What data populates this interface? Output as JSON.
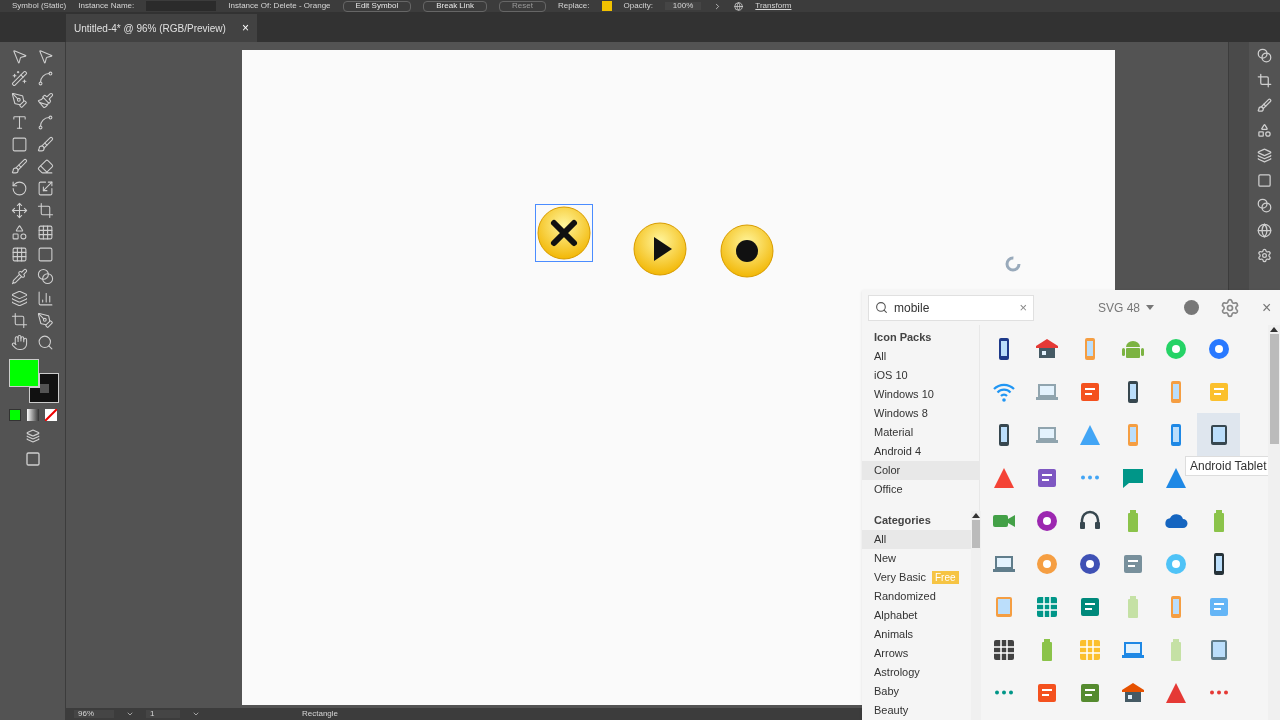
{
  "control_bar": {
    "object_type": "Symbol (Static)",
    "instance_name_label": "Instance Name:",
    "instance_of": "Instance Of: Delete - Orange",
    "buttons": [
      {
        "label": "Edit Symbol",
        "disabled": false
      },
      {
        "label": "Break Link",
        "disabled": false
      },
      {
        "label": "Reset",
        "disabled": true
      }
    ],
    "replace_label": "Replace:",
    "opacity_label": "Opacity:",
    "opacity_value": "100%",
    "transform_label": "Transform"
  },
  "document_tab": {
    "title": "Untitled-4* @ 96% (RGB/Preview)",
    "close": "×"
  },
  "artboard": {
    "symbols": [
      {
        "kind": "close",
        "selected": true
      },
      {
        "kind": "play",
        "selected": false
      },
      {
        "kind": "record",
        "selected": false
      }
    ]
  },
  "status_bar": {
    "zoom": "96%",
    "artboard_number": "1",
    "tool": "Rectangle"
  },
  "icon_panel": {
    "search": {
      "value": "mobile",
      "clear": "×"
    },
    "format": "SVG 48",
    "close": "×",
    "icon_packs": {
      "heading": "Icon Packs",
      "items": [
        {
          "label": "All",
          "selected": false
        },
        {
          "label": "iOS 10",
          "selected": false
        },
        {
          "label": "Windows 10",
          "selected": false
        },
        {
          "label": "Windows 8",
          "selected": false
        },
        {
          "label": "Material",
          "selected": false
        },
        {
          "label": "Android 4",
          "selected": false
        },
        {
          "label": "Color",
          "selected": true
        },
        {
          "label": "Office",
          "selected": false
        }
      ]
    },
    "categories": {
      "heading": "Categories",
      "items": [
        {
          "label": "All",
          "selected": true
        },
        {
          "label": "New",
          "selected": false
        },
        {
          "label": "Very Basic",
          "selected": false,
          "badge": "Free"
        },
        {
          "label": "Randomized",
          "selected": false
        },
        {
          "label": "Alphabet",
          "selected": false
        },
        {
          "label": "Animals",
          "selected": false
        },
        {
          "label": "Arrows",
          "selected": false
        },
        {
          "label": "Astrology",
          "selected": false
        },
        {
          "label": "Baby",
          "selected": false
        },
        {
          "label": "Beauty",
          "selected": false
        }
      ]
    },
    "icon_rows": [
      [
        {
          "selected": false
        },
        {
          "selected": false
        },
        {
          "selected": false
        },
        {
          "selected": false
        },
        {
          "selected": false
        },
        {
          "selected": false
        }
      ],
      [
        {
          "selected": false
        },
        {
          "selected": false
        },
        {
          "selected": false
        },
        {
          "selected": false
        },
        {
          "selected": false
        },
        {
          "selected": false
        }
      ],
      [
        {
          "selected": false
        },
        {
          "selected": false
        },
        {
          "selected": false
        },
        {
          "selected": false
        },
        {
          "selected": false
        },
        {
          "selected": true
        }
      ],
      [
        {
          "selected": false
        },
        {
          "selected": false
        },
        {
          "selected": false
        },
        {
          "selected": false
        },
        {
          "selected": false
        }
      ],
      [
        {
          "selected": false
        },
        {
          "selected": false
        },
        {
          "selected": false
        },
        {
          "selected": false
        },
        {
          "selected": false
        },
        {
          "selected": false
        }
      ],
      [
        {
          "selected": false
        },
        {
          "selected": false
        },
        {
          "selected": false
        },
        {
          "selected": false
        },
        {
          "selected": false
        },
        {
          "selected": false
        }
      ],
      [
        {
          "selected": false
        },
        {
          "selected": false
        },
        {
          "selected": false
        },
        {
          "selected": false
        },
        {
          "selected": false
        },
        {
          "selected": false
        }
      ],
      [
        {
          "selected": false
        },
        {
          "selected": false
        },
        {
          "selected": false
        },
        {
          "selected": false
        },
        {
          "selected": false
        },
        {
          "selected": false
        }
      ],
      [
        {
          "selected": false
        },
        {
          "selected": false
        },
        {
          "selected": false
        },
        {
          "selected": false
        },
        {
          "selected": false
        },
        {
          "selected": false
        }
      ]
    ],
    "tooltip": "Android Tablet"
  }
}
